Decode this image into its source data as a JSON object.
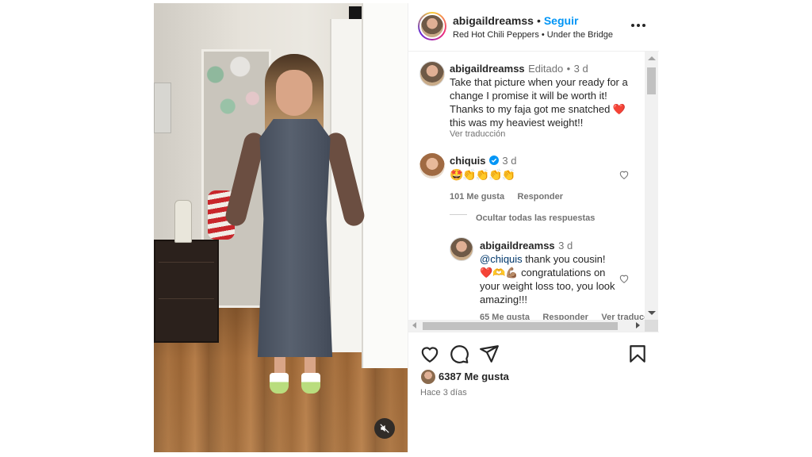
{
  "post": {
    "username": "abigaildreamss",
    "follow_label": "Seguir",
    "music": "Red Hot Chili Peppers • Under the Bridge",
    "caption": {
      "username": "abigaildreamss",
      "edited_label": "Editado",
      "time": "3 d",
      "text": "Take that picture when your ready for a change I promise it will be worth it! Thanks to my faja got me snatched ❤️ this was my heaviest weight!!",
      "translate_label": "Ver traducción"
    },
    "comments": [
      {
        "username": "chiquis",
        "time": "3 d",
        "text": "🤩👏👏👏👏",
        "likes": "101 Me gusta",
        "reply_label": "Responder",
        "hide_replies_label": "Ocultar todas las respuestas"
      }
    ],
    "reply": {
      "username": "abigaildreamss",
      "time": "3 d",
      "mention": "@chiquis",
      "text_line1": " thank you cousin!",
      "text_rest": "❤️🫶💪🏽 congratulations on your weight loss too, you look amazing!!!",
      "likes_partial": "65 Me gusta",
      "reply_partial": "Responder",
      "translate_partial": "Ver traducción"
    },
    "like_count": "6387 Me gusta",
    "posted_ago": "Hace 3 días"
  },
  "colors": {
    "follow": "#0095f6",
    "heart_red": "#e02424",
    "text": "#262626",
    "muted": "#737373"
  },
  "icons": [
    "more-icon",
    "heart-icon",
    "comment-icon",
    "share-icon",
    "save-icon",
    "mute-icon",
    "verified-icon"
  ]
}
